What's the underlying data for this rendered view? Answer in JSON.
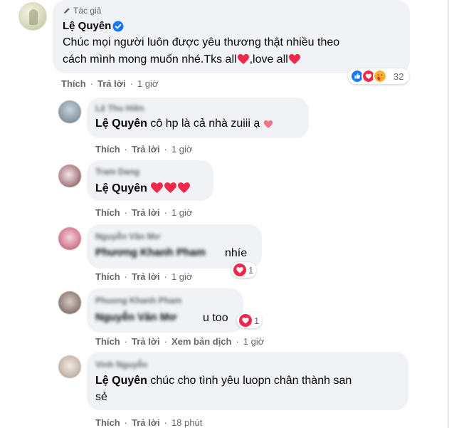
{
  "main_comment": {
    "badge": "Tác giả",
    "author": "Lệ Quyên",
    "line1": "Chúc mọi người luôn được yêu thương thật nhiều theo",
    "line2_a": "cách mình mong muốn nhé.Tks all",
    "line2_b": ",love all",
    "reaction_count": "32",
    "like": "Thích",
    "reply": "Trả lời",
    "time": "1 giờ"
  },
  "replies": [
    {
      "blurred_name": "Lệ Thu Hiền",
      "author": "Lệ Quyên",
      "text": "cô hp là cả nhà zuiii ạ",
      "like": "Thích",
      "reply": "Trả lời",
      "time": "1 giờ"
    },
    {
      "blurred_name": "Tram Dang",
      "author": "Lệ Quyên",
      "text": "",
      "like": "Thích",
      "reply": "Trả lời",
      "time": "1 giờ"
    },
    {
      "blurred_name": "Nguyễn Văn Mơ",
      "blurred_tag": "Phương Khanh Pham",
      "text": "nhíe",
      "reaction_count": "1",
      "like": "Thích",
      "reply": "Trả lời",
      "time": "1 giờ"
    },
    {
      "blurred_name": "Phuong Khanh Pham",
      "blurred_tag": "Nguyễn Văn Mơ",
      "text": "u too",
      "reaction_count": "1",
      "like": "Thích",
      "reply": "Trả lời",
      "translate": "Xem bản dịch",
      "time": "1 giờ"
    },
    {
      "blurred_name": "Vinh Nguyễn",
      "author": "Lệ Quyên",
      "line1": "chúc cho tình yêu luopn chân thành san",
      "line2": "sẻ",
      "like": "Thích",
      "reply": "Trả lời",
      "time": "18 phút"
    }
  ],
  "icons": {
    "badge": "pen-icon",
    "verified": "verified-check-icon",
    "heart": "heart-emoji-icon",
    "reactions": [
      "like-reaction-icon",
      "love-reaction-icon",
      "care-reaction-icon"
    ]
  },
  "colors": {
    "bubble": "#f0f2f5",
    "heart": "#f02849",
    "like_blue": "#1877f2",
    "secondary_text": "#65676b"
  }
}
